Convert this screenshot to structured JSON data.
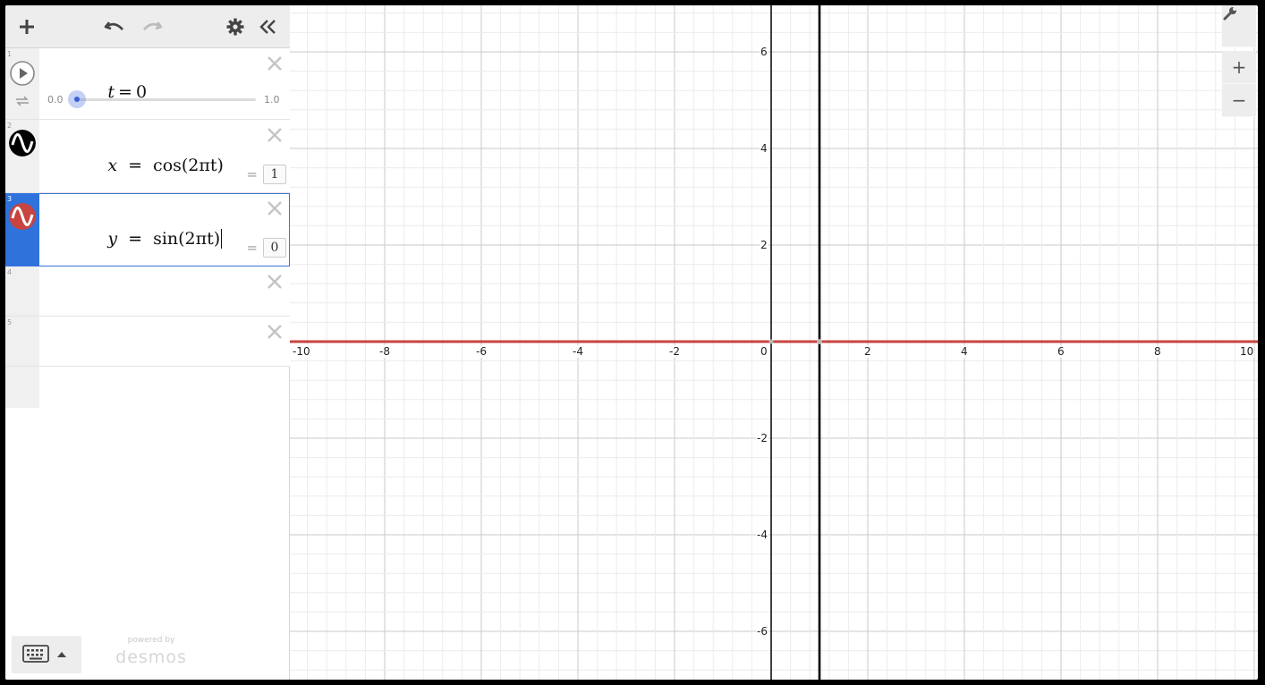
{
  "toolbar": {
    "add_label": "+",
    "icons": [
      "plus-icon",
      "undo-icon",
      "redo-icon",
      "gear-icon",
      "collapse-icon"
    ]
  },
  "expressions": [
    {
      "index": "1",
      "lhs": "t",
      "eq": "=",
      "rhs": "0",
      "slider_min": "0.0",
      "slider_max": "1.0",
      "slider_value": 0
    },
    {
      "index": "2",
      "lhs": "x",
      "eq": "=",
      "rhs": "cos(2πt)",
      "value": "1",
      "color": "#000000"
    },
    {
      "index": "3",
      "lhs": "y",
      "eq": "=",
      "rhs": "sin(2πt)",
      "value": "0",
      "color": "#c74440"
    },
    {
      "index": "4"
    },
    {
      "index": "5"
    }
  ],
  "eval_sign": "=",
  "footer": {
    "powered": "powered by",
    "brand": "desmos"
  },
  "graph": {
    "x_ticks": [
      "-10",
      "-8",
      "-6",
      "-4",
      "-2",
      "0",
      "2",
      "4",
      "6",
      "8",
      "10"
    ],
    "y_ticks": [
      "6",
      "4",
      "2",
      "-2",
      "-4",
      "-6"
    ],
    "zoom_in": "+",
    "zoom_out": "−"
  },
  "colors": {
    "accent": "#2f72dc",
    "red_curve": "#c74440",
    "black_curve": "#000000"
  }
}
